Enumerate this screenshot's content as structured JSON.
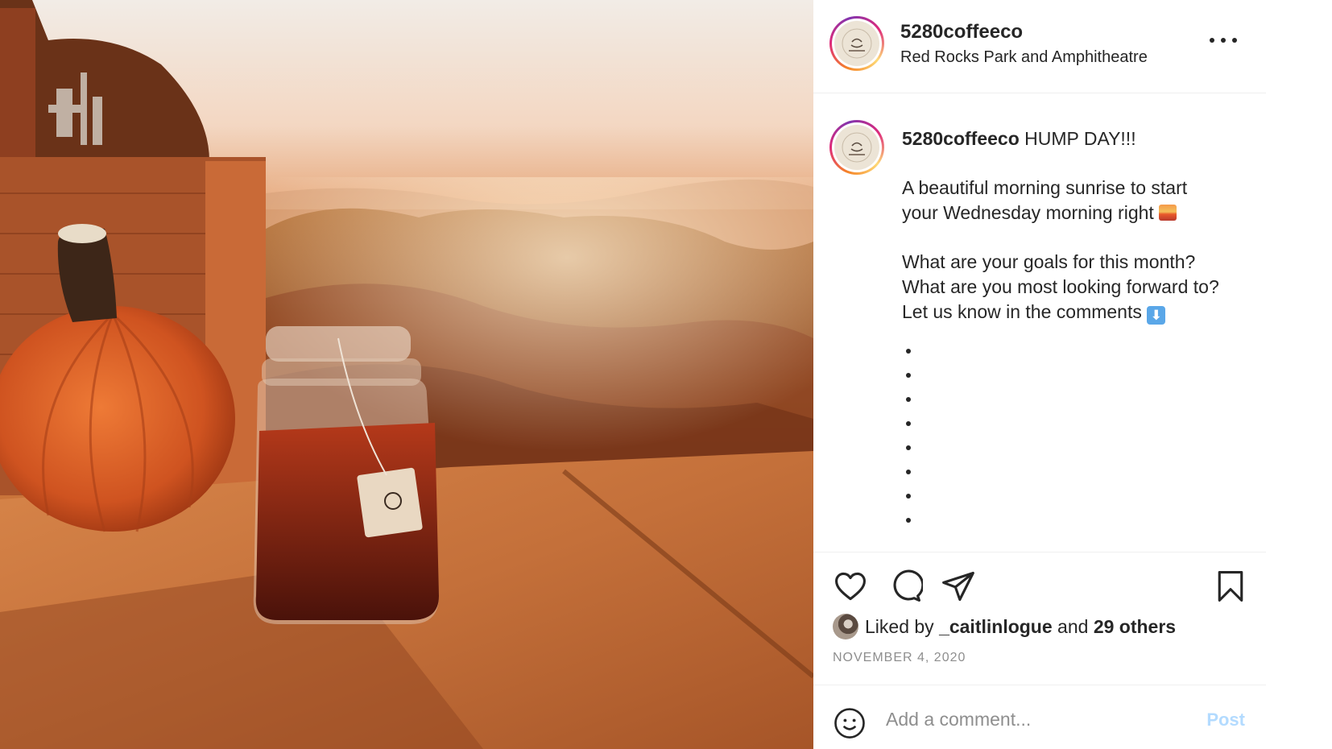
{
  "post": {
    "username": "5280coffeeco",
    "location": "Red Rocks Park and Amphitheatre",
    "more_icon": "more-horizontal-icon",
    "image_alt": "Pumpkin and a mason jar of cold brew coffee on a red rock ledge at sunrise"
  },
  "caption": {
    "username": "5280coffeeco",
    "title": "HUMP DAY!!!",
    "line1": "A beautiful morning sunrise to start",
    "line2": "your Wednesday morning right",
    "line3": "What are your goals for this month?",
    "line4": "What are you most looking forward to?",
    "line5": "Let us know in the comments",
    "sunrise_emoji": "sunrise-emoji",
    "arrow_emoji": "down-arrow-emoji",
    "arrow_glyph": "⬇"
  },
  "actions": {
    "like_icon": "heart-icon",
    "comment_icon": "comment-icon",
    "share_icon": "send-icon",
    "save_icon": "bookmark-icon"
  },
  "likes": {
    "prefix": "Liked by",
    "user": "_caitlinlogue",
    "and": "and",
    "others": "29 others"
  },
  "date": "NOVEMBER 4, 2020",
  "comment": {
    "emoji_icon": "smiley-icon",
    "placeholder": "Add a comment...",
    "post_label": "Post",
    "post_color": "#b3dbff"
  },
  "colors": {
    "text": "#262626",
    "muted": "#8e8e8e",
    "divider": "#efefef"
  }
}
